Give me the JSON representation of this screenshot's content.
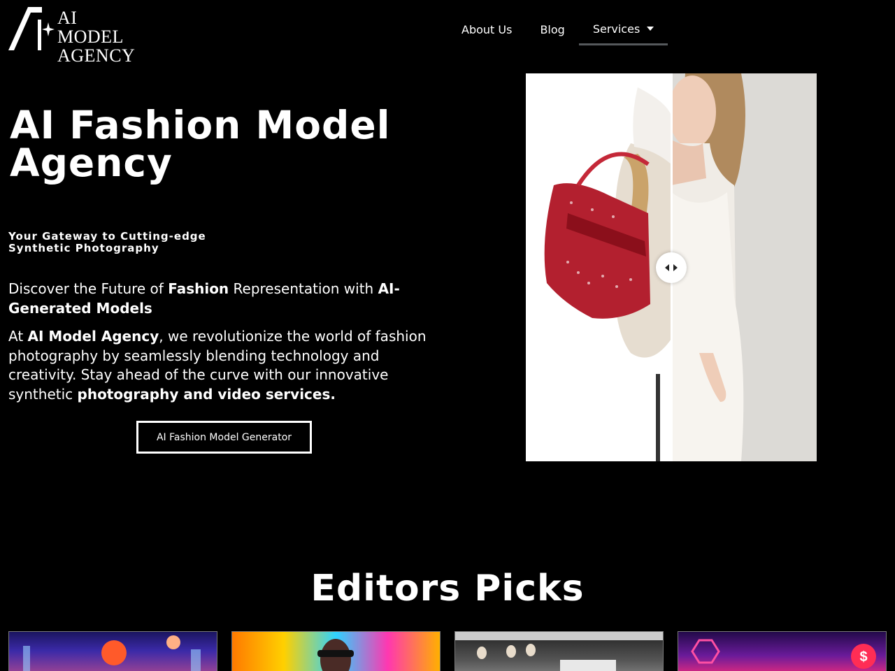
{
  "header": {
    "logo": {
      "line1": "AI MODEL",
      "line2": "AGENCY",
      "icon": "a-sparkle-logo"
    },
    "nav": [
      {
        "label": "About Us"
      },
      {
        "label": "Blog"
      },
      {
        "label": "Services",
        "has_dropdown": true,
        "active": true
      }
    ]
  },
  "hero": {
    "title": "AI Fashion Model Agency",
    "tagline": "Your Gateway to Cutting-edge Synthetic Photography",
    "lead": {
      "p1": "Discover the Future of ",
      "b1": "Fashion",
      "p2": " Representation with ",
      "b2": "AI-Generated Models"
    },
    "body": {
      "p1": "At ",
      "b1": "AI Model Agency",
      "p2": ", we revolutionize the world of fashion photography by seamlessly blending technology and creativity. Stay ahead of the curve with our innovative synthetic ",
      "b2": "photography and video services."
    },
    "cta_label": "AI Fashion Model Generator",
    "compare": {
      "left_alt": "Mannequin with red checkered tote bag",
      "right_alt": "AI model in white dress",
      "split_position": 0.5
    }
  },
  "picks": {
    "title": "Editors Picks",
    "cards": [
      {
        "theme": "neon-city-astronaut"
      },
      {
        "theme": "rainbow-fashion-portrait"
      },
      {
        "theme": "retail-store-mannequins"
      },
      {
        "theme": "cyber-neon-finance"
      }
    ]
  },
  "colors": {
    "background": "#000000",
    "text": "#ffffff",
    "nav_underline": "#55595c"
  }
}
